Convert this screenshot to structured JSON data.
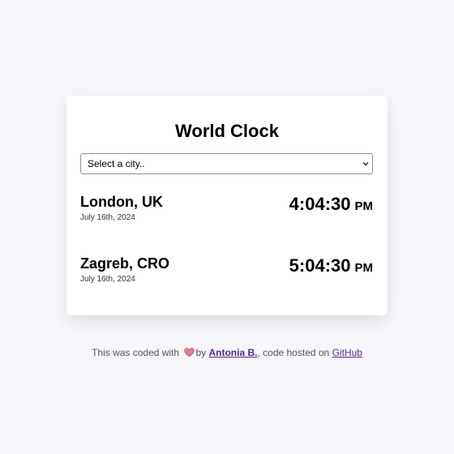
{
  "card": {
    "title": "World Clock",
    "select": {
      "value": "Select a city.."
    },
    "cities": [
      {
        "name": "London, UK",
        "date": "July 16th, 2024",
        "time": "4:04:30",
        "ampm": "PM"
      },
      {
        "name": "Zagreb, CRO",
        "date": "July 16th, 2024",
        "time": "5:04:30",
        "ampm": "PM"
      }
    ]
  },
  "footer": {
    "prefix": "This was coded with",
    "by": "by",
    "author": "Antonia B.",
    "middle": ", code hosted on",
    "host": "GitHub",
    "heart_icon": "heart-icon"
  },
  "colors": {
    "background": "#f7f6fb",
    "card": "#ffffff",
    "link": "#5a2a8c",
    "heart": "#e57a8c"
  }
}
